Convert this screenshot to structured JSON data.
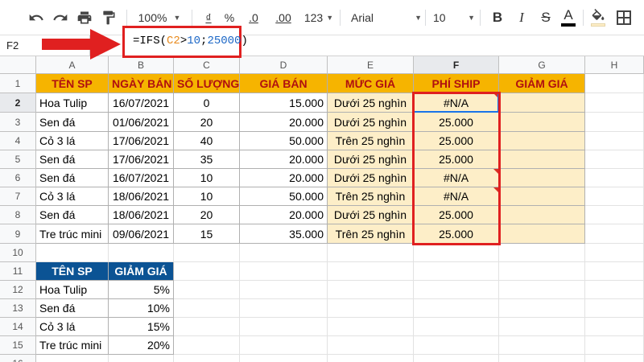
{
  "toolbar": {
    "zoom": "100%",
    "currency": "₫",
    "percent": "%",
    "dec_decrease": ".0",
    "dec_increase": ".00",
    "more_formats": "123",
    "font": "Arial",
    "font_size": "10",
    "bold": "B",
    "italic": "I",
    "strike": "S",
    "text_color": "A"
  },
  "name_box": "F2",
  "formula": {
    "prefix": "=IFS(",
    "ref": "C2",
    "op": ">",
    "n1": "10",
    "sep": ";",
    "n2": "25000",
    "suffix": ")"
  },
  "columns": [
    "A",
    "B",
    "C",
    "D",
    "E",
    "F",
    "G",
    "H"
  ],
  "rows": [
    "1",
    "2",
    "3",
    "4",
    "5",
    "6",
    "7",
    "8",
    "9",
    "10",
    "11",
    "12",
    "13",
    "14",
    "15",
    "16"
  ],
  "main_table": {
    "headers": [
      "TÊN SP",
      "NGÀY BÁN",
      "SỐ LƯỢNG",
      "GIÁ BÁN",
      "MỨC GIÁ",
      "PHÍ SHIP",
      "GIẢM GIÁ"
    ],
    "data": [
      [
        "Hoa Tulip",
        "16/07/2021",
        "0",
        "15.000",
        "Dưới 25 nghìn",
        "#N/A",
        ""
      ],
      [
        "Sen đá",
        "01/06/2021",
        "20",
        "20.000",
        "Dưới 25 nghìn",
        "25.000",
        ""
      ],
      [
        "Cỏ 3 lá",
        "17/06/2021",
        "40",
        "50.000",
        "Trên 25 nghìn",
        "25.000",
        ""
      ],
      [
        "Sen đá",
        "17/06/2021",
        "35",
        "20.000",
        "Dưới 25 nghìn",
        "25.000",
        ""
      ],
      [
        "Sen đá",
        "16/07/2021",
        "10",
        "20.000",
        "Dưới 25 nghìn",
        "#N/A",
        ""
      ],
      [
        "Cỏ 3 lá",
        "18/06/2021",
        "10",
        "50.000",
        "Trên 25 nghìn",
        "#N/A",
        ""
      ],
      [
        "Sen đá",
        "18/06/2021",
        "20",
        "20.000",
        "Dưới 25 nghìn",
        "25.000",
        ""
      ],
      [
        "Tre trúc mini",
        "09/06/2021",
        "15",
        "35.000",
        "Trên 25 nghìn",
        "25.000",
        ""
      ]
    ]
  },
  "discount_table": {
    "headers": [
      "TÊN SP",
      "GIẢM GIÁ"
    ],
    "data": [
      [
        "Hoa Tulip",
        "5%"
      ],
      [
        "Sen đá",
        "10%"
      ],
      [
        "Cỏ 3 lá",
        "15%"
      ],
      [
        "Tre trúc mini",
        "20%"
      ]
    ]
  },
  "colors": {
    "header_orange": "#f6b400",
    "header_text_red": "#b01010",
    "header_blue": "#0b5394",
    "fill_yellow": "#fdeec8",
    "highlight_red": "#e02020",
    "selection_blue": "#1a73e8"
  }
}
